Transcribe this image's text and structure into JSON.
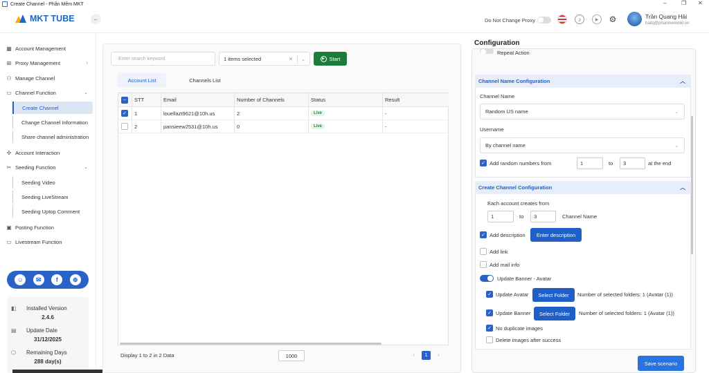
{
  "window": {
    "title": "Create Channel - Phần Mềm MKT"
  },
  "header": {
    "logo_text": "MKT TUBE",
    "proxy_label": "Do Not Change Proxy",
    "user": {
      "name": "Trần Quang Hải",
      "email": "haitq@phanmemmkt.vn"
    }
  },
  "sidebar": {
    "items": [
      {
        "label": "Account Management",
        "icon": "grid-icon"
      },
      {
        "label": "Proxy Management",
        "icon": "proxy-icon"
      },
      {
        "label": "Manage Channel",
        "icon": "channel-icon"
      },
      {
        "label": "Channel Function",
        "icon": "function-icon"
      },
      {
        "label": "Create Channel"
      },
      {
        "label": "Change Channel Information"
      },
      {
        "label": "Share channel administration"
      },
      {
        "label": "Account Interaction",
        "icon": "interaction-icon"
      },
      {
        "label": "Seeding Function",
        "icon": "seeding-icon"
      },
      {
        "label": "Seeding Video"
      },
      {
        "label": "Seeding LiveStream"
      },
      {
        "label": "Seeding Uptop Comment"
      },
      {
        "label": "Posting Function",
        "icon": "posting-icon"
      },
      {
        "label": "Livestream Function",
        "icon": "livestream-icon"
      }
    ],
    "info": {
      "installed_version_label": "Installed Version",
      "installed_version": "2.4.6",
      "update_date_label": "Update Date",
      "update_date": "31/12/2025",
      "remaining_label": "Remaining Days",
      "remaining": "288 day(s)"
    }
  },
  "toolbar": {
    "search_placeholder": "Enter search keyword",
    "selected_text": "1 items selected",
    "start_label": "Start"
  },
  "tabs": {
    "account_list": "Account List",
    "channels_list": "Channels List"
  },
  "table": {
    "headers": [
      "STT",
      "Email",
      "Number of Channels",
      "Status",
      "Result"
    ],
    "rows": [
      {
        "stt": "1",
        "email": "louellazt9621@10h.us",
        "channels": "2",
        "status": "Live",
        "result": "-",
        "checked": true
      },
      {
        "stt": "2",
        "email": "pansieew2531@10h.us",
        "channels": "0",
        "status": "Live",
        "result": "-",
        "checked": false
      }
    ],
    "footer_text": "Display 1 to 2 in 2 Data",
    "page_size": "1000",
    "page": "1",
    "prev": "‹",
    "next": "›"
  },
  "config": {
    "title": "Configuration",
    "repeat_action": "Repeat Action",
    "channel_name_section": "Channel Name Configuration",
    "channel_name_label": "Channel Name",
    "channel_name_value": "Random US name",
    "username_label": "Username",
    "username_value": "By channel name",
    "add_random_label": "Add random numbers from",
    "random_from": "1",
    "to_label": "to",
    "random_to": "3",
    "at_end_label": "at the end",
    "create_section": "Create Channel Configuration",
    "each_account_label": "Each account creates from",
    "create_from": "1",
    "create_to": "3",
    "channel_name_unit": "Channel Name",
    "add_description": "Add description",
    "enter_description": "Enter description",
    "add_link": "Add link",
    "add_mail_info": "Add mail info",
    "update_banner_avatar": "Update Banner - Avatar",
    "update_avatar": "Update Avatar",
    "update_banner": "Update Banner",
    "select_folder": "Select Folder",
    "avatar_folders": "Number of selected folders: 1  (Avatar (1))",
    "banner_folders": "Number of selected folders: 1  (Avatar (1))",
    "no_duplicate": "No duplicate images",
    "delete_after": "Delete images after success",
    "save_label": "Save scenario"
  },
  "colors": {
    "primary": "#1f5fc7",
    "start": "#1d7c3c",
    "live_bg": "#e4f6e7",
    "live_text": "#1f8b3a"
  }
}
